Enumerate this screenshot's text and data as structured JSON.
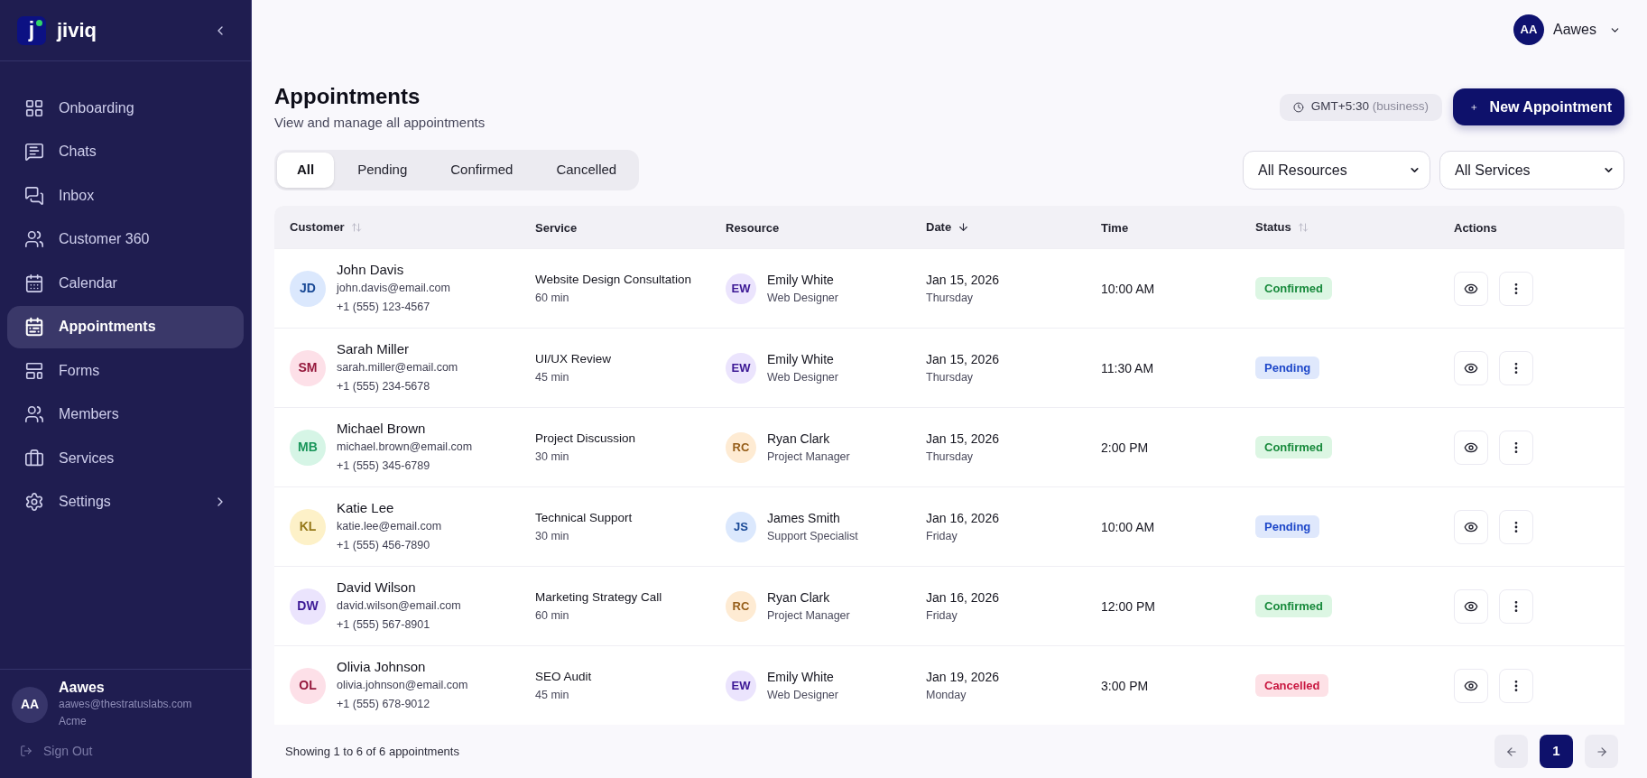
{
  "sidebar": {
    "logo": {
      "mark": "j",
      "name": "jiviq"
    },
    "items": [
      {
        "label": "Onboarding",
        "selected": false,
        "kind": "link"
      },
      {
        "label": "Chats",
        "selected": false,
        "kind": "link"
      },
      {
        "label": "Inbox",
        "selected": false,
        "kind": "link"
      },
      {
        "label": "Customer 360",
        "selected": false,
        "kind": "link"
      },
      {
        "label": "Calendar",
        "selected": false,
        "kind": "link"
      },
      {
        "label": "Appointments",
        "selected": true,
        "kind": "link"
      },
      {
        "label": "Forms",
        "selected": false,
        "kind": "link"
      },
      {
        "label": "Members",
        "selected": false,
        "kind": "link"
      },
      {
        "label": "Services",
        "selected": false,
        "kind": "link"
      },
      {
        "label": "Settings",
        "selected": false,
        "kind": "group"
      }
    ],
    "user": {
      "initials": "AA",
      "name": "Aawes",
      "email": "aawes@thestratuslabs.com",
      "org": "Acme"
    },
    "sign_out": "Sign Out"
  },
  "header": {
    "user": {
      "initials": "AA",
      "name": "Aawes"
    }
  },
  "page": {
    "title": "Appointments",
    "subtitle": "View and manage all appointments",
    "timezone": {
      "label": "GMT+5:30",
      "note": "(business)"
    },
    "new_button": "New Appointment"
  },
  "tabs": [
    {
      "label": "All",
      "selected": true
    },
    {
      "label": "Pending",
      "selected": false
    },
    {
      "label": "Confirmed",
      "selected": false
    },
    {
      "label": "Cancelled",
      "selected": false
    }
  ],
  "filters": [
    {
      "value": "All Resources"
    },
    {
      "value": "All Services"
    }
  ],
  "table": {
    "columns": [
      {
        "label": "Customer",
        "sortable": true,
        "sorted": false
      },
      {
        "label": "Service",
        "sortable": false,
        "sorted": false
      },
      {
        "label": "Resource",
        "sortable": false,
        "sorted": false
      },
      {
        "label": "Date",
        "sortable": true,
        "sorted": true
      },
      {
        "label": "Time",
        "sortable": false,
        "sorted": false
      },
      {
        "label": "Status",
        "sortable": true,
        "sorted": false
      },
      {
        "label": "Actions",
        "sortable": false,
        "sorted": false
      }
    ],
    "rows": [
      {
        "customer": {
          "initials": "JD",
          "color": "#dbe8fd",
          "name": "John Davis",
          "email": "john.davis@email.com",
          "phone": "+1 (555) 123-4567"
        },
        "service": {
          "name": "Website Design Consultation",
          "duration": "60 min"
        },
        "resource": {
          "initials": "EW",
          "color": "#ebe4fd",
          "name": "Emily White",
          "role": "Web Designer"
        },
        "date": "Jan 15, 2026",
        "weekday": "Thursday",
        "time": "10:00 AM",
        "status": {
          "label": "Confirmed",
          "kind": "confirmed"
        }
      },
      {
        "customer": {
          "initials": "SM",
          "color": "#fde0e8",
          "name": "Sarah Miller",
          "email": "sarah.miller@email.com",
          "phone": "+1 (555) 234-5678"
        },
        "service": {
          "name": "UI/UX Review",
          "duration": "45 min"
        },
        "resource": {
          "initials": "EW",
          "color": "#ebe4fd",
          "name": "Emily White",
          "role": "Web Designer"
        },
        "date": "Jan 15, 2026",
        "weekday": "Thursday",
        "time": "11:30 AM",
        "status": {
          "label": "Pending",
          "kind": "pending"
        }
      },
      {
        "customer": {
          "initials": "MB",
          "color": "#d6f5e6",
          "name": "Michael Brown",
          "email": "michael.brown@email.com",
          "phone": "+1 (555) 345-6789"
        },
        "service": {
          "name": "Project Discussion",
          "duration": "30 min"
        },
        "resource": {
          "initials": "RC",
          "color": "#feebd3",
          "name": "Ryan Clark",
          "role": "Project Manager"
        },
        "date": "Jan 15, 2026",
        "weekday": "Thursday",
        "time": "2:00 PM",
        "status": {
          "label": "Confirmed",
          "kind": "confirmed"
        }
      },
      {
        "customer": {
          "initials": "KL",
          "color": "#fdf1c8",
          "name": "Katie Lee",
          "email": "katie.lee@email.com",
          "phone": "+1 (555) 456-7890"
        },
        "service": {
          "name": "Technical Support",
          "duration": "30 min"
        },
        "resource": {
          "initials": "JS",
          "color": "#dbe8fd",
          "name": "James Smith",
          "role": "Support Specialist"
        },
        "date": "Jan 16, 2026",
        "weekday": "Friday",
        "time": "10:00 AM",
        "status": {
          "label": "Pending",
          "kind": "pending"
        }
      },
      {
        "customer": {
          "initials": "DW",
          "color": "#ebe4fd",
          "name": "David Wilson",
          "email": "david.wilson@email.com",
          "phone": "+1 (555) 567-8901"
        },
        "service": {
          "name": "Marketing Strategy Call",
          "duration": "60 min"
        },
        "resource": {
          "initials": "RC",
          "color": "#feebd3",
          "name": "Ryan Clark",
          "role": "Project Manager"
        },
        "date": "Jan 16, 2026",
        "weekday": "Friday",
        "time": "12:00 PM",
        "status": {
          "label": "Confirmed",
          "kind": "confirmed"
        }
      },
      {
        "customer": {
          "initials": "OL",
          "color": "#fde0e8",
          "name": "Olivia Johnson",
          "email": "olivia.johnson@email.com",
          "phone": "+1 (555) 678-9012"
        },
        "service": {
          "name": "SEO Audit",
          "duration": "45 min"
        },
        "resource": {
          "initials": "EW",
          "color": "#ebe4fd",
          "name": "Emily White",
          "role": "Web Designer"
        },
        "date": "Jan 19, 2026",
        "weekday": "Monday",
        "time": "3:00 PM",
        "status": {
          "label": "Cancelled",
          "kind": "cancelled"
        }
      }
    ]
  },
  "footer": {
    "summary": "Showing 1 to 6 of 6 appointments",
    "prev": {
      "disabled": true
    },
    "pages": [
      {
        "label": "1",
        "selected": true
      }
    ],
    "next": {
      "disabled": true
    }
  }
}
